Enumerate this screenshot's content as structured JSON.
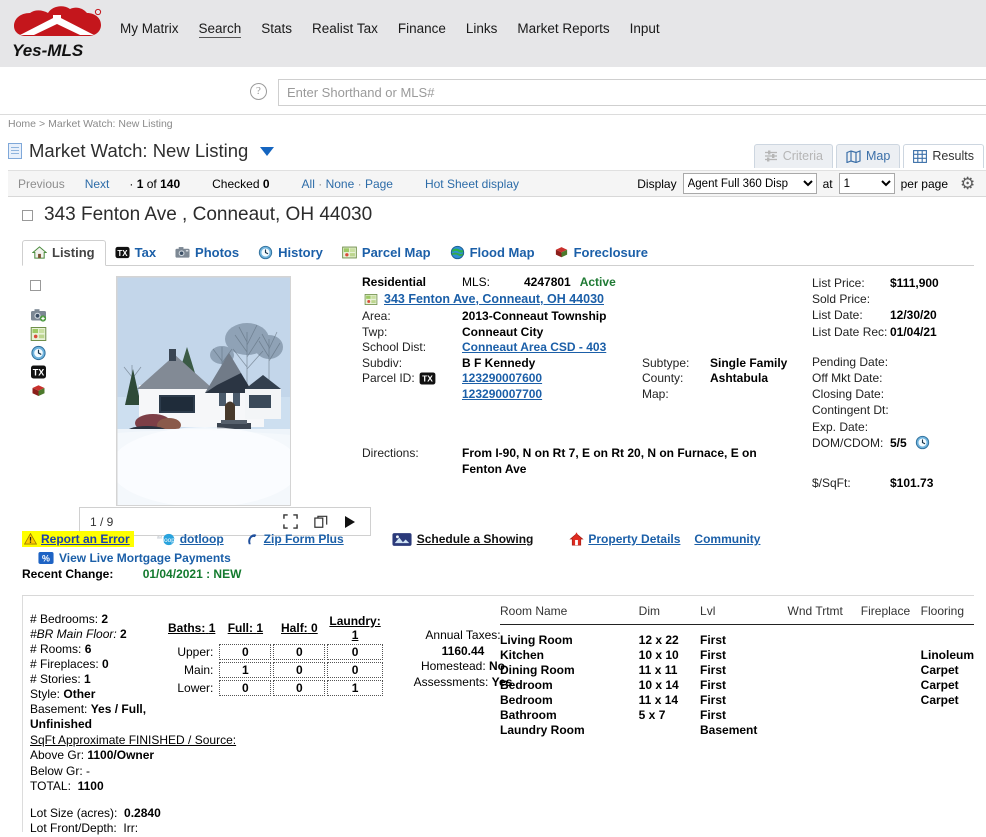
{
  "brand": {
    "name": "Yes-MLS",
    "color": "#c4161c"
  },
  "nav": {
    "items": [
      {
        "label": "My Matrix",
        "active": false
      },
      {
        "label": "Search",
        "active": true
      },
      {
        "label": "Stats",
        "active": false
      },
      {
        "label": "Realist Tax",
        "active": false
      },
      {
        "label": "Finance",
        "active": false
      },
      {
        "label": "Links",
        "active": false
      },
      {
        "label": "Market Reports",
        "active": false
      },
      {
        "label": "Input",
        "active": false
      }
    ]
  },
  "search": {
    "placeholder": "Enter Shorthand or MLS#",
    "value": "",
    "help_icon": "question-mark-icon"
  },
  "breadcrumb": {
    "home": "Home",
    "separator": ">",
    "current": "Market Watch: New Listing"
  },
  "page": {
    "title": "Market Watch: New Listing",
    "icon": "document-icon",
    "caret": "chevron-down-icon"
  },
  "view_tabs": [
    {
      "label": "Criteria",
      "icon": "sliders-icon",
      "state": "disabled"
    },
    {
      "label": "Map",
      "icon": "map-icon",
      "state": "enabled"
    },
    {
      "label": "Results",
      "icon": "grid-icon",
      "state": "active"
    }
  ],
  "toolbar": {
    "previous": "Previous",
    "next": "Next",
    "position_prefix": "·",
    "position": "1 of 140",
    "position_current": "1",
    "position_total": "140",
    "checked_label": "Checked",
    "checked_count": "0",
    "all": "All",
    "dot1": "·",
    "none": "None",
    "dot2": "·",
    "page": "Page",
    "hot_sheet": "Hot Sheet display",
    "display_label": "Display",
    "display_value": "Agent Full 360 Disp",
    "at_label": "at",
    "per_page_value": "1",
    "per_page_label": "per page",
    "settings_icon": "gear-icon"
  },
  "listing": {
    "address_title": "343 Fenton Ave , Conneaut, OH 44030",
    "checkbox": "row-checkbox",
    "tabs": [
      {
        "label": "Listing",
        "icon": "house-icon",
        "active": true
      },
      {
        "label": "Tax",
        "icon": "tx-icon",
        "active": false
      },
      {
        "label": "Photos",
        "icon": "camera-icon",
        "active": false
      },
      {
        "label": "History",
        "icon": "clock-icon",
        "active": false
      },
      {
        "label": "Parcel Map",
        "icon": "parcel-map-icon",
        "active": false
      },
      {
        "label": "Flood Map",
        "icon": "globe-icon",
        "active": false
      },
      {
        "label": "Foreclosure",
        "icon": "foreclosure-icon",
        "active": false
      }
    ],
    "side_icons": [
      "camera-icon",
      "parcel-map-icon",
      "clock-icon",
      "tx-icon",
      "foreclosure-icon"
    ],
    "photo": {
      "counter": "1 / 9",
      "expand_icon": "fullscreen-icon",
      "copy_icon": "duplicate-icon",
      "play_icon": "play-icon"
    },
    "property_type": "Residential",
    "mls_label": "MLS:",
    "mls_number": "4247801",
    "status": "Active",
    "address_link": "343 Fenton Ave, Conneaut, OH 44030",
    "address_link_icon": "map-pin-icon",
    "fields": {
      "area_label": "Area:",
      "area_value": "2013-Conneaut Township",
      "twp_label": "Twp:",
      "twp_value": "Conneaut City",
      "school_label": "School Dist:",
      "school_value": "Conneaut Area CSD - 403",
      "subdiv_label": "Subdiv:",
      "subdiv_value": "B F Kennedy",
      "parcel_label": "Parcel ID:",
      "parcel_icon": "tx-icon",
      "parcel_value1": "123290007600",
      "parcel_value2": "123290007700",
      "subtype_label": "Subtype:",
      "subtype_value": "Single Family",
      "county_label": "County:",
      "county_value": "Ashtabula",
      "map_label": "Map:",
      "map_value": "",
      "directions_label": "Directions:",
      "directions_value": "From I-90, N on Rt 7, E on Rt 20, N on Furnace, E on Fenton Ave"
    },
    "prices": {
      "list_price_label": "List Price:",
      "list_price_value": "$111,900",
      "sold_price_label": "Sold Price:",
      "sold_price_value": "",
      "list_date_label": "List Date:",
      "list_date_value": "12/30/20",
      "list_date_rec_label": "List Date Rec:",
      "list_date_rec_value": "01/04/21",
      "pending_date_label": "Pending Date:",
      "pending_date_value": "",
      "off_mkt_label": "Off Mkt Date:",
      "off_mkt_value": "",
      "closing_label": "Closing Date:",
      "closing_value": "",
      "contingent_label": "Contingent Dt:",
      "contingent_value": "",
      "exp_label": "Exp. Date:",
      "exp_value": "",
      "dom_label": "DOM/CDOM:",
      "dom_value": "5/5",
      "dom_icon": "clock-icon",
      "sqft_price_label": "$/SqFt:",
      "sqft_price_value": "$101.73"
    },
    "actions": {
      "report_error": "Report an Error",
      "report_error_icon": "warning-icon",
      "dotloop": "dotloop",
      "dotloop_icon": "dotloop-icon",
      "zipform": "Zip Form Plus",
      "zipform_icon": "zipform-icon",
      "schedule": "Schedule a Showing",
      "schedule_icon": "calendar-photo-icon",
      "property_details": "Property Details",
      "property_details_icon": "house-red-icon",
      "community": "Community",
      "mortgage": "View Live Mortgage Payments",
      "mortgage_icon": "percent-icon"
    },
    "recent_change": {
      "label": "Recent Change:",
      "value": "01/04/2021 : NEW"
    },
    "stats": {
      "bedrooms_label": "# Bedrooms:",
      "bedrooms_value": "2",
      "br_main_label": "#BR Main Floor:",
      "br_main_value": "2",
      "rooms_label": "# Rooms:",
      "rooms_value": "6",
      "fireplaces_label": "# Fireplaces:",
      "fireplaces_value": "0",
      "stories_label": "# Stories:",
      "stories_value": "1",
      "style_label": "Style:",
      "style_value": "Other",
      "basement_label": "Basement:",
      "basement_value": "Yes / Full, Unfinished"
    },
    "baths_table": {
      "headers": [
        {
          "label": "Baths:",
          "value": "1"
        },
        {
          "label": "Full:",
          "value": "1"
        },
        {
          "label": "Half:",
          "value": "0"
        },
        {
          "label": "Laundry:",
          "value": "1"
        }
      ],
      "rows": [
        {
          "level": "Upper:",
          "full": "0",
          "half": "0",
          "laundry": "0"
        },
        {
          "level": "Main:",
          "full": "1",
          "half": "0",
          "laundry": "0"
        },
        {
          "level": "Lower:",
          "full": "0",
          "half": "0",
          "laundry": "1"
        }
      ]
    },
    "taxes": {
      "annual_label": "Annual Taxes:",
      "annual_value": "1160.44",
      "homestead_label": "Homestead:",
      "homestead_value": "No",
      "assessments_label": "Assessments:",
      "assessments_value": "Yes"
    },
    "rooms_table": {
      "columns": [
        "Room Name",
        "Dim",
        "Lvl",
        "Wnd Trtmt",
        "Fireplace",
        "Flooring"
      ],
      "rows": [
        {
          "name": "Living Room",
          "dim": "12 x 22",
          "lvl": "First",
          "wnd": "",
          "fireplace": "",
          "flooring": ""
        },
        {
          "name": "Kitchen",
          "dim": "10 x 10",
          "lvl": "First",
          "wnd": "",
          "fireplace": "",
          "flooring": "Linoleum"
        },
        {
          "name": "Dining Room",
          "dim": "11 x 11",
          "lvl": "First",
          "wnd": "",
          "fireplace": "",
          "flooring": "Carpet"
        },
        {
          "name": "Bedroom",
          "dim": "10 x 14",
          "lvl": "First",
          "wnd": "",
          "fireplace": "",
          "flooring": "Carpet"
        },
        {
          "name": "Bedroom",
          "dim": "11 x 14",
          "lvl": "First",
          "wnd": "",
          "fireplace": "",
          "flooring": "Carpet"
        },
        {
          "name": "Bathroom",
          "dim": "5 x 7",
          "lvl": "First",
          "wnd": "",
          "fireplace": "",
          "flooring": ""
        },
        {
          "name": "Laundry Room",
          "dim": "",
          "lvl": "Basement",
          "wnd": "",
          "fireplace": "",
          "flooring": ""
        }
      ]
    },
    "sqft": {
      "header": "SqFt Approximate FINISHED / Source:",
      "above_label": "Above Gr:",
      "above_value": "1100/Owner",
      "below_label": "Below Gr:",
      "below_value": "-",
      "total_label": "TOTAL:",
      "total_value": "1100"
    },
    "lot": {
      "size_label": "Lot Size (acres):",
      "size_value": "0.2840",
      "front_label": "Lot Front/Depth:",
      "front_value": "Irr:"
    }
  }
}
